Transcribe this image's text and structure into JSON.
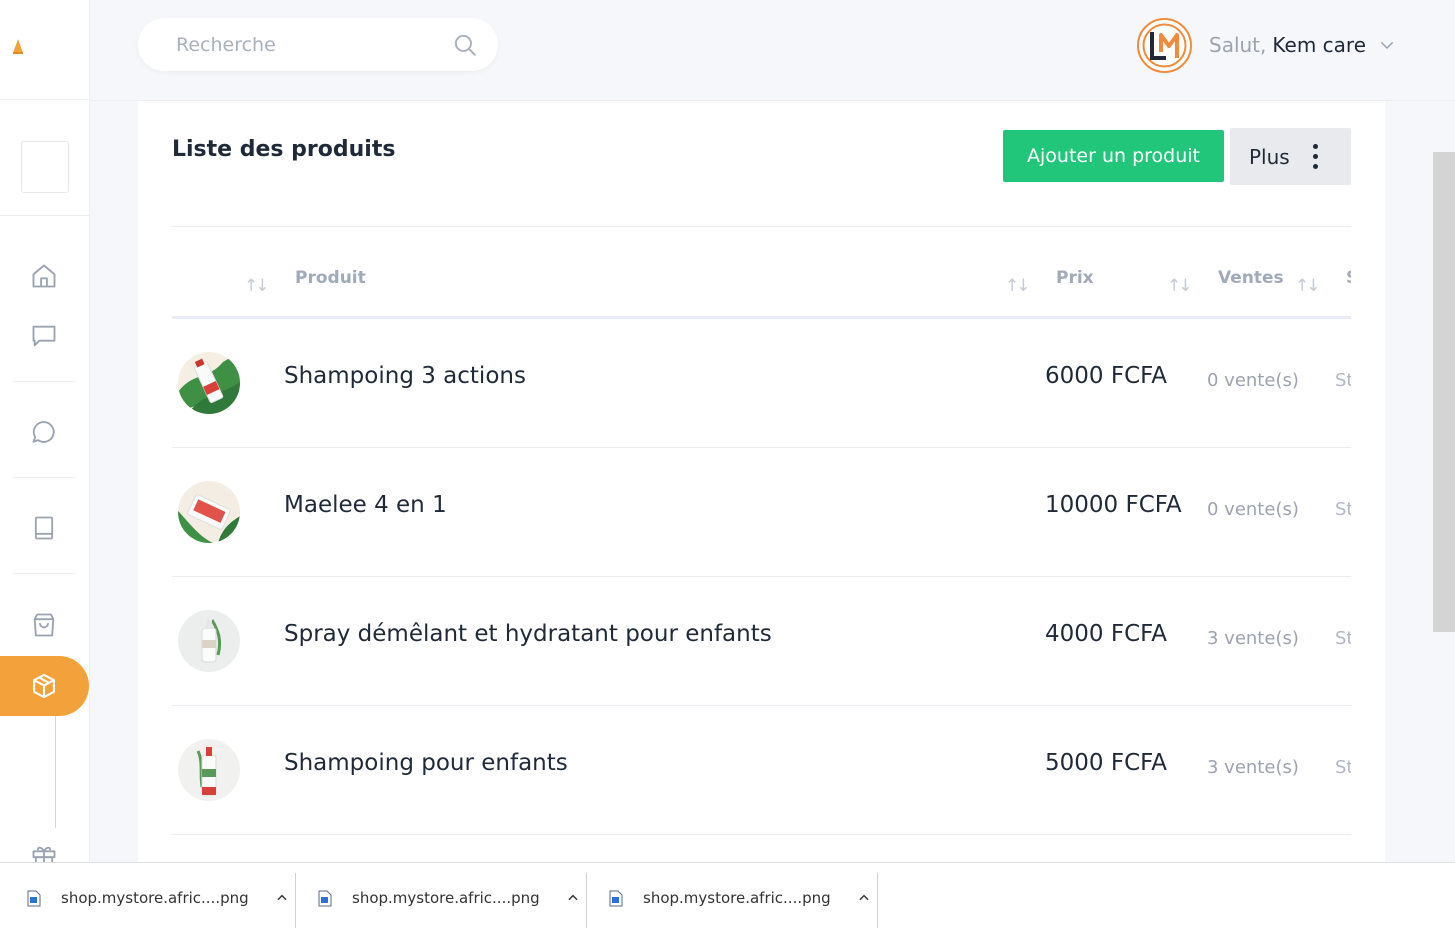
{
  "header": {
    "search": {
      "placeholder": "Recherche"
    },
    "user": {
      "greeting": "Salut,",
      "name": "Kem care",
      "avatar_initials": "LM"
    }
  },
  "sidebar": {
    "items": [
      {
        "icon": "home-icon",
        "active": false
      },
      {
        "icon": "message-square-icon",
        "active": false
      },
      {
        "icon": "chat-bubble-icon",
        "active": false
      },
      {
        "icon": "book-icon",
        "active": false
      },
      {
        "icon": "shopping-bag-icon",
        "active": false
      },
      {
        "icon": "box-icon",
        "active": true
      },
      {
        "icon": "gift-icon",
        "active": false
      }
    ]
  },
  "main": {
    "title": "Liste des produits",
    "add_button": "Ajouter un produit",
    "more_button": "Plus",
    "columns": [
      "Produit",
      "Prix",
      "Ventes",
      "S"
    ],
    "products": [
      {
        "name": "Shampoing 3 actions",
        "price": "6000 FCFA",
        "sales": "0 vente(s)",
        "stock": "St"
      },
      {
        "name": "Maelee 4 en 1",
        "price": "10000 FCFA",
        "sales": "0 vente(s)",
        "stock": "St"
      },
      {
        "name": "Spray démêlant et hydratant pour enfants",
        "price": "4000 FCFA",
        "sales": "3 vente(s)",
        "stock": "St"
      },
      {
        "name": "Shampoing pour enfants",
        "price": "5000 FCFA",
        "sales": "3 vente(s)",
        "stock": "St"
      }
    ]
  },
  "downloads": [
    {
      "filename": "shop.mystore.afric....png"
    },
    {
      "filename": "shop.mystore.afric....png"
    },
    {
      "filename": "shop.mystore.afric....png"
    }
  ],
  "colors": {
    "accent": "#f3a13a",
    "primary_button": "#22c67a",
    "avatar_ring": "#f08a3c"
  }
}
